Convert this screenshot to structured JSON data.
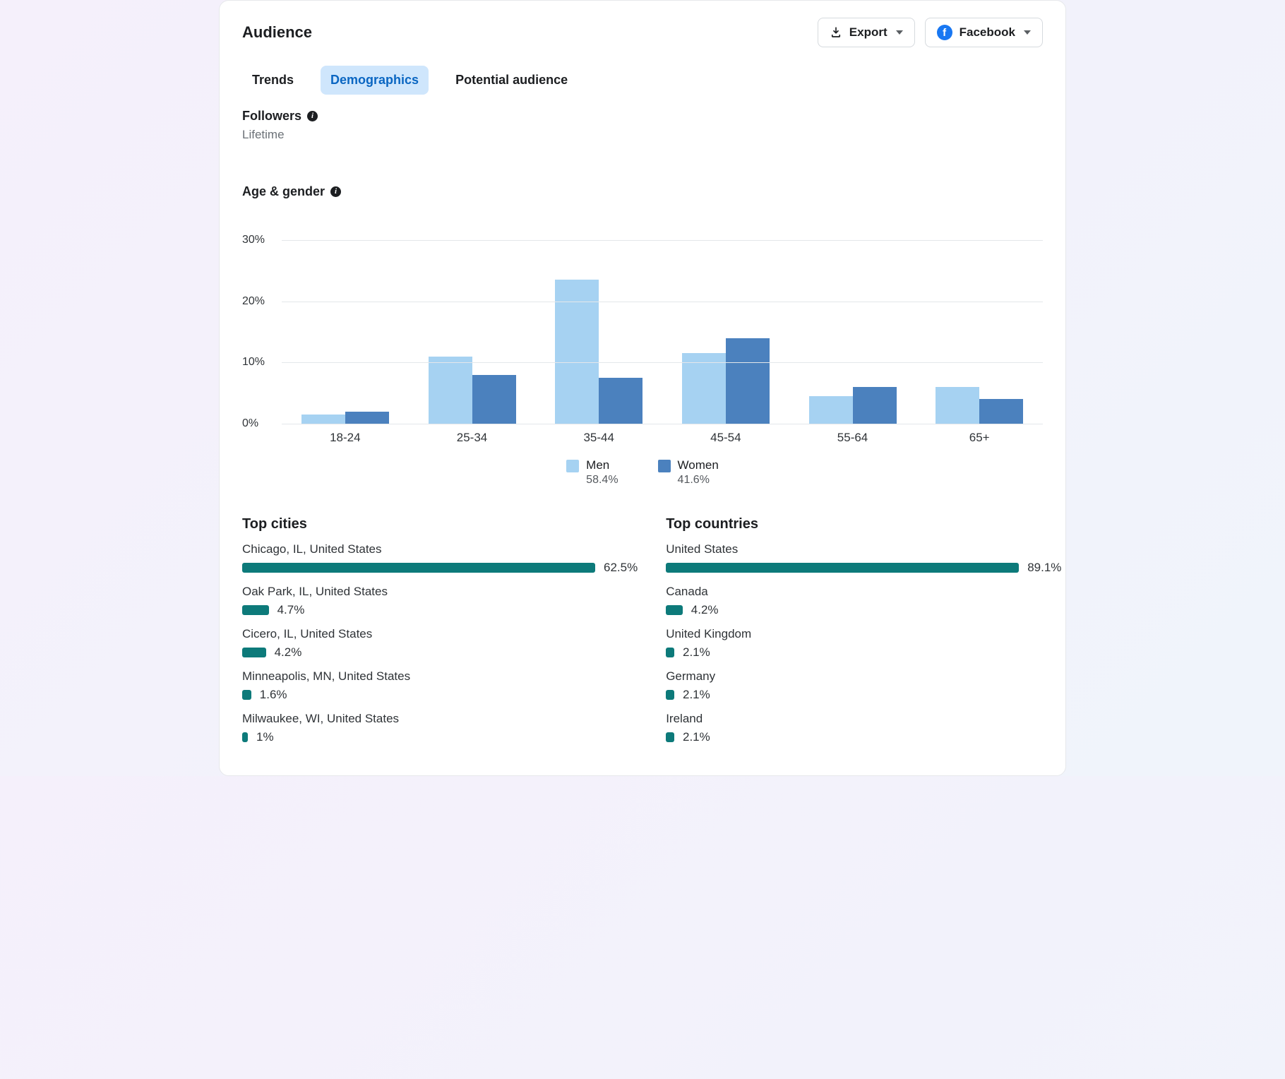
{
  "header": {
    "title": "Audience",
    "export_label": "Export",
    "platform_label": "Facebook"
  },
  "tabs": [
    "Trends",
    "Demographics",
    "Potential audience"
  ],
  "followers": {
    "title": "Followers",
    "subtitle": "Lifetime"
  },
  "age_gender": {
    "title": "Age & gender",
    "legend": [
      {
        "name": "Men",
        "pct": "58.4%"
      },
      {
        "name": "Women",
        "pct": "41.6%"
      }
    ]
  },
  "top_cities": {
    "title": "Top cities",
    "items": [
      {
        "label": "Chicago,  IL,  United States",
        "pct": 62.5
      },
      {
        "label": "Oak Park,  IL,  United States",
        "pct": 4.7
      },
      {
        "label": "Cicero,  IL,  United States",
        "pct": 4.2
      },
      {
        "label": "Minneapolis,  MN,  United States",
        "pct": 1.6
      },
      {
        "label": "Milwaukee,  WI,  United States",
        "pct": 1.0
      }
    ]
  },
  "top_countries": {
    "title": "Top countries",
    "items": [
      {
        "label": "United States",
        "pct": 89.1
      },
      {
        "label": "Canada",
        "pct": 4.2
      },
      {
        "label": "United Kingdom",
        "pct": 2.1
      },
      {
        "label": "Germany",
        "pct": 2.1
      },
      {
        "label": "Ireland",
        "pct": 2.1
      }
    ]
  },
  "chart_data": {
    "type": "bar",
    "title": "Age & gender",
    "xlabel": "",
    "ylabel": "",
    "ylim": [
      0,
      30
    ],
    "y_ticks": [
      0,
      10,
      20,
      30
    ],
    "categories": [
      "18-24",
      "25-34",
      "35-44",
      "45-54",
      "55-64",
      "65+"
    ],
    "series": [
      {
        "name": "Men",
        "color": "#A6D2F2",
        "values": [
          1.5,
          11.0,
          23.5,
          11.5,
          4.5,
          6.0
        ]
      },
      {
        "name": "Women",
        "color": "#4B81BE",
        "values": [
          2.0,
          8.0,
          7.5,
          14.0,
          6.0,
          4.0
        ]
      }
    ],
    "legend_totals": {
      "Men": 58.4,
      "Women": 41.6
    }
  },
  "colors": {
    "bar_men": "#A6D2F2",
    "bar_women": "#4B81BE",
    "hbar": "#0d7a7a"
  }
}
